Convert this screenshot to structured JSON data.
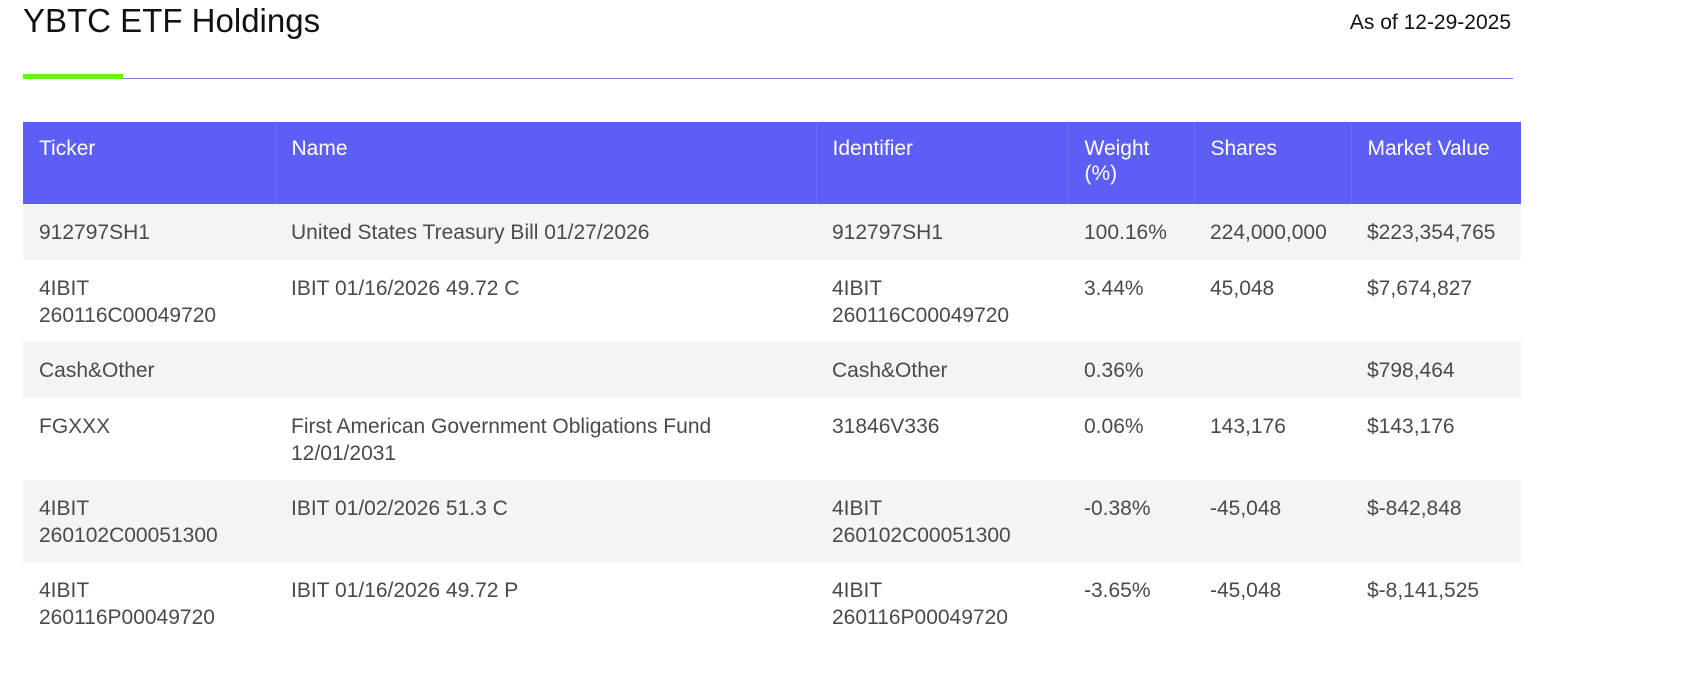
{
  "header": {
    "title": "YBTC ETF Holdings",
    "as_of": "As of 12-29-2025"
  },
  "table": {
    "columns": [
      "Ticker",
      "Name",
      "Identifier",
      "Weight (%)",
      "Shares",
      "Market Value"
    ],
    "rows": [
      [
        "912797SH1",
        "United States Treasury Bill 01/27/2026",
        "912797SH1",
        "100.16%",
        "224,000,000",
        "$223,354,765"
      ],
      [
        "4IBIT 260116C00049720",
        "IBIT 01/16/2026 49.72 C",
        "4IBIT 260116C00049720",
        "3.44%",
        "45,048",
        "$7,674,827"
      ],
      [
        "Cash&Other",
        "",
        "Cash&Other",
        "0.36%",
        "",
        "$798,464"
      ],
      [
        "FGXXX",
        "First American Government Obligations Fund 12/01/2031",
        "31846V336",
        "0.06%",
        "143,176",
        "$143,176"
      ],
      [
        "4IBIT 260102C00051300",
        "IBIT 01/02/2026 51.3 C",
        "4IBIT 260102C00051300",
        "-0.38%",
        "-45,048",
        "$-842,848"
      ],
      [
        "4IBIT 260116P00049720",
        "IBIT 01/16/2026 49.72 P",
        "4IBIT 260116P00049720",
        "-3.65%",
        "-45,048",
        "$-8,141,525"
      ]
    ]
  }
}
